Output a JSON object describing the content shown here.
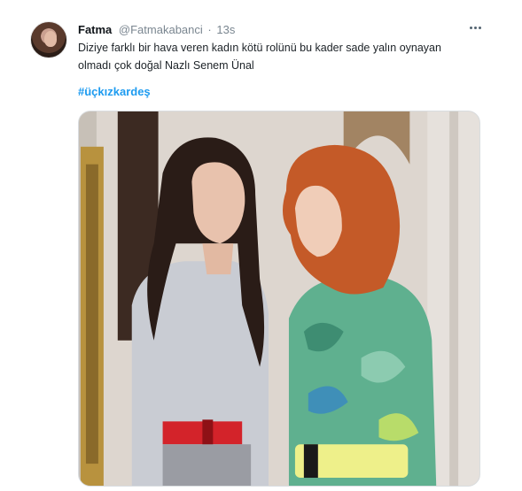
{
  "tweet": {
    "display_name": "Fatma",
    "handle": "@Fatmakabanci",
    "separator": "·",
    "time": "13s",
    "text": "Diziye farklı bir hava veren kadın kötü rolünü bu kader sade yalın oynayan olmadı çok doğal Nazlı Senem Ünal",
    "hashtag": "#üçkızkardeş",
    "icons": {
      "avatar": "profile-photo",
      "more": "more-horizontal-icon"
    },
    "media": {
      "description_kind": "photo",
      "colors": {
        "wall": "#ddd6cf",
        "frame_gold": "#b8923e",
        "dark_hair": "#2a1c17",
        "red_hair": "#c45a28",
        "grey_shirt": "#c9ccd3",
        "red_belt": "#d3232a",
        "green_dress": "#5fb08f",
        "yellow_belt": "#eef08a"
      }
    }
  }
}
